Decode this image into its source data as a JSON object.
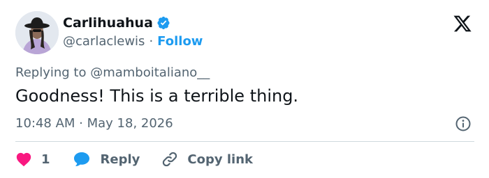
{
  "author": {
    "display_name": "Carlihuahua",
    "handle": "@carlaclewis",
    "separator": "·",
    "follow_label": "Follow"
  },
  "reply_context": {
    "prefix": "Replying to ",
    "mention": "@mamboitaliano__"
  },
  "tweet": {
    "text": "Goodness! This is a terrible thing.",
    "timestamp": "10:48 AM · May 18, 2026"
  },
  "actions": {
    "like_count": "1",
    "reply_label": "Reply",
    "copy_link_label": "Copy link"
  },
  "icons": {
    "verified": "verified-badge-icon",
    "logo": "x-logo-icon",
    "info": "info-icon",
    "like": "heart-icon",
    "reply": "speech-bubble-icon",
    "copy": "link-icon"
  },
  "colors": {
    "accent": "#1d9bf0",
    "like": "#f91880",
    "text": "#0f1419",
    "muted": "#536471",
    "divider": "#cfd9de"
  }
}
